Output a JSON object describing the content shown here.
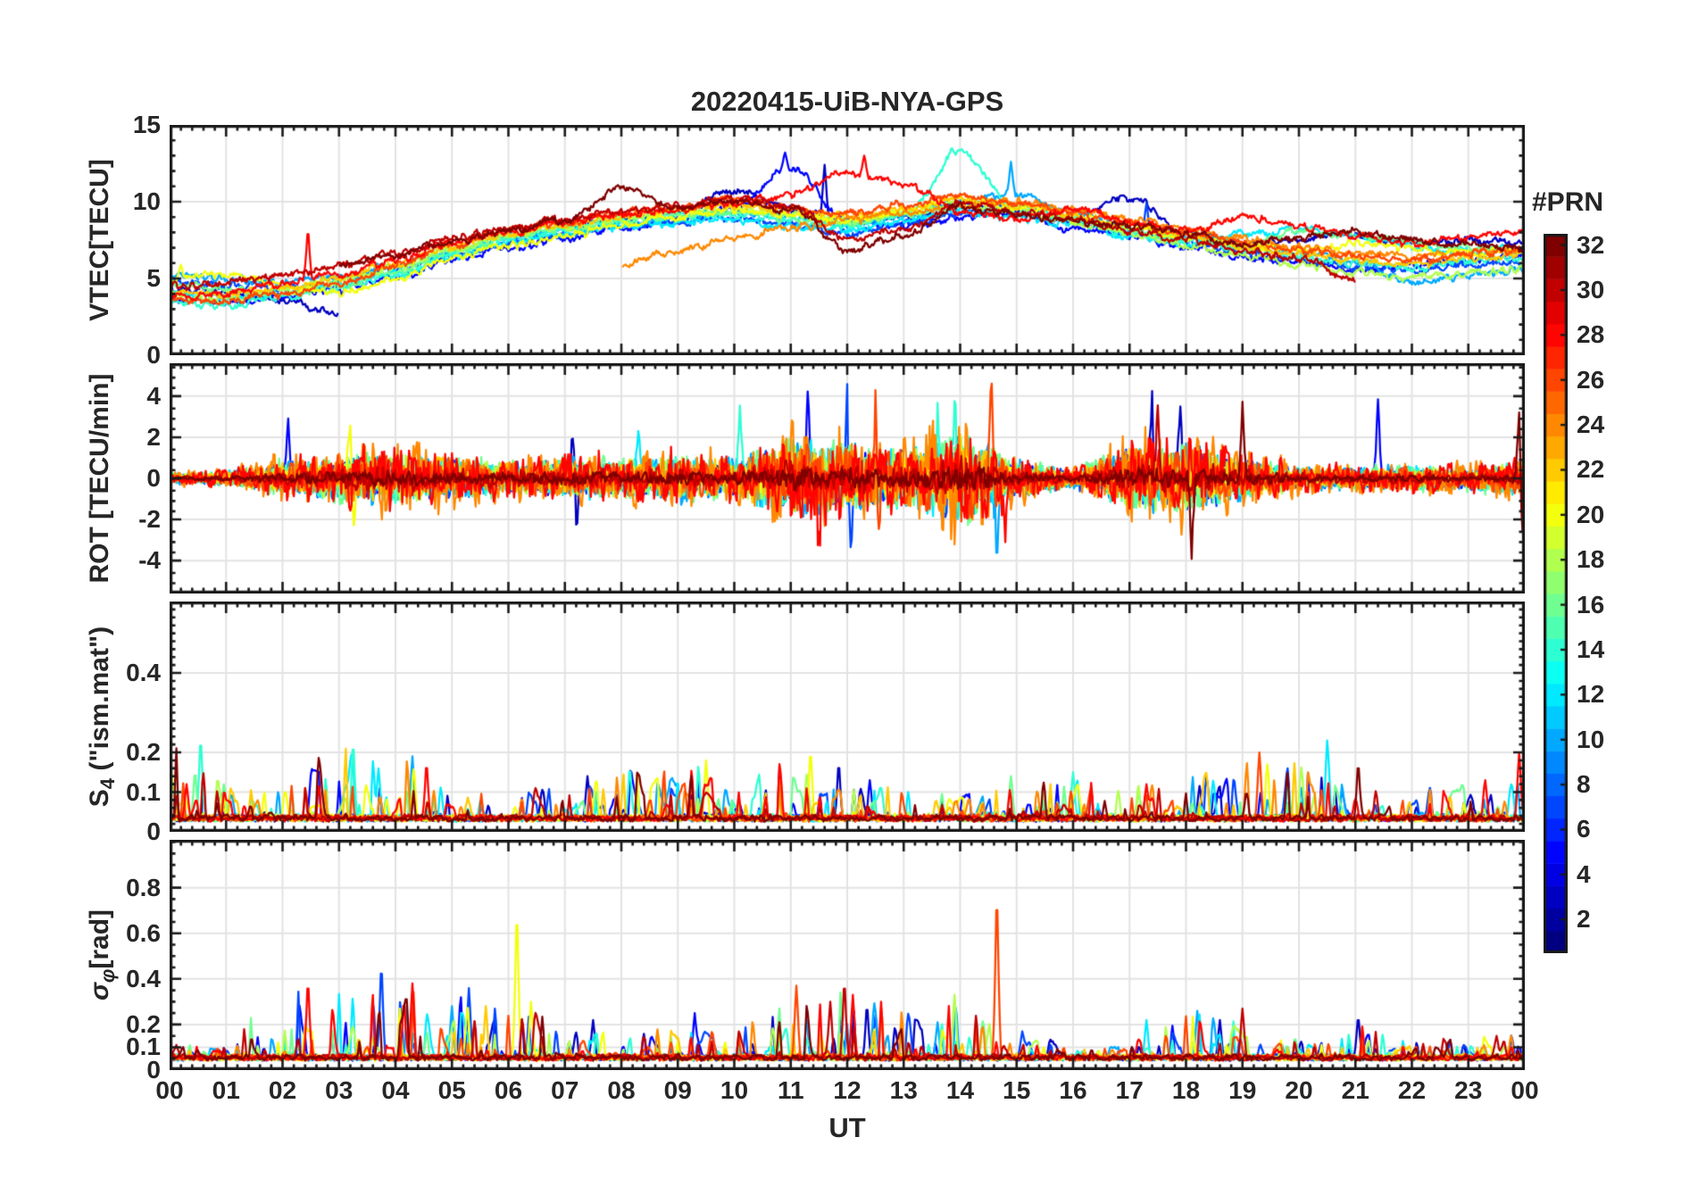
{
  "title": "20220415-UiB-NYA-GPS",
  "colors": {
    "background": "#ffffff",
    "frame": "#1a1a1a",
    "grid": "#e3e3e3",
    "text": "#262626"
  },
  "colorbar": {
    "title": "#PRN",
    "min": 1,
    "max": 32,
    "tick_values": [
      2,
      4,
      6,
      8,
      10,
      12,
      14,
      16,
      18,
      20,
      22,
      24,
      26,
      28,
      30,
      32
    ],
    "colormap": "jet"
  },
  "chart_data": {
    "type": "line",
    "x": {
      "label": "UT",
      "min": 0,
      "max": 24,
      "tick_labels": [
        "00",
        "01",
        "02",
        "03",
        "04",
        "05",
        "06",
        "07",
        "08",
        "09",
        "10",
        "11",
        "12",
        "13",
        "14",
        "15",
        "16",
        "17",
        "18",
        "19",
        "20",
        "21",
        "22",
        "23",
        "00"
      ],
      "minor_step": 0.2,
      "grid": true
    },
    "panels": [
      {
        "id": "vtec",
        "kind": "tec",
        "ylabel": {
          "pre": "VTEC[TECU]",
          "sub": "",
          "post": ""
        },
        "italic": false,
        "ylim": [
          0,
          15
        ],
        "yticks": [
          0,
          5,
          10,
          15
        ],
        "ytick_labels": [
          "0",
          "5",
          "10",
          "15"
        ],
        "minor_step": 1,
        "noise_amp": 0.22,
        "series": [
          {
            "prn": 3,
            "values": [
              4.3,
              4.1,
              3.5,
              2.8,
              null,
              null,
              null,
              8.4,
              8.8,
              9.2,
              10.8,
              9.5,
              8.7,
              9.0,
              9.8,
              9.2,
              8.8,
              10.3,
              8.0,
              7.3,
              7.6,
              7.8,
              7.2,
              7.5,
              7.3
            ]
          },
          {
            "prn": 5,
            "values": [
              3.6,
              3.3,
              3.9,
              4.3,
              5.0,
              6.2,
              7.0,
              7.6,
              8.3,
              8.8,
              9.6,
              12.2,
              8.9,
              8.4,
              9.0,
              9.5,
              8.2,
              7.7,
              7.1,
              6.4,
              6.0,
              5.6,
              5.9,
              6.2,
              6.4
            ]
          },
          {
            "prn": 7,
            "values": [
              4.8,
              4.6,
              4.4,
              4.9,
              5.6,
              6.6,
              7.3,
              7.9,
              8.5,
              8.7,
              9.0,
              8.5,
              8.0,
              8.6,
              9.2,
              9.7,
              8.8,
              8.0,
              7.4,
              6.6,
              6.2,
              5.8,
              5.5,
              5.8,
              6.0
            ]
          },
          {
            "prn": 10,
            "values": [
              5.2,
              5.0,
              4.7,
              5.1,
              5.9,
              6.8,
              7.7,
              8.1,
              8.6,
              8.9,
              9.4,
              9.0,
              8.6,
              9.0,
              9.9,
              10.6,
              9.2,
              8.4,
              7.8,
              7.1,
              6.7,
              6.1,
              4.7,
              5.2,
              5.6
            ]
          },
          {
            "prn": 12,
            "values": [
              4.0,
              3.7,
              4.1,
              4.6,
              5.3,
              6.4,
              7.4,
              8.0,
              8.4,
              8.6,
              8.8,
              8.4,
              8.2,
              8.8,
              9.3,
              9.0,
              8.5,
              7.8,
              7.3,
              7.9,
              8.2,
              7.7,
              7.1,
              6.8,
              7.0
            ]
          },
          {
            "prn": 14,
            "values": [
              3.4,
              3.2,
              3.8,
              4.4,
              5.2,
              6.5,
              7.5,
              8.2,
              8.7,
              9.0,
              9.2,
              8.8,
              8.5,
              9.1,
              13.2,
              9.6,
              8.8,
              8.0,
              7.5,
              6.9,
              6.4,
              6.0,
              5.7,
              6.1,
              6.3
            ]
          },
          {
            "prn": 16,
            "values": [
              4.6,
              4.3,
              4.0,
              4.5,
              5.4,
              6.7,
              7.6,
              8.3,
              8.8,
              9.1,
              9.3,
              8.9,
              8.6,
              9.2,
              9.7,
              9.3,
              8.9,
              8.1,
              7.6,
              7.0,
              8.1,
              7.8,
              7.4,
              7.0,
              6.7
            ]
          },
          {
            "prn": 18,
            "values": [
              3.9,
              3.6,
              4.2,
              4.8,
              5.7,
              6.9,
              7.8,
              8.4,
              8.9,
              9.3,
              9.6,
              9.1,
              8.7,
              9.3,
              9.9,
              9.4,
              8.7,
              7.9,
              7.2,
              6.5,
              5.9,
              5.4,
              5.0,
              5.3,
              5.7
            ]
          },
          {
            "prn": 20,
            "values": [
              4.9,
              5.3,
              4.5,
              4.1,
              5.0,
              6.3,
              7.2,
              7.8,
              8.5,
              9.0,
              9.5,
              9.2,
              8.8,
              9.4,
              10.1,
              9.6,
              9.0,
              8.3,
              7.7,
              7.2,
              6.8,
              7.3,
              7.0,
              6.6,
              6.9
            ]
          },
          {
            "prn": 22,
            "values": [
              4.1,
              3.9,
              4.4,
              5.0,
              6.0,
              7.1,
              7.9,
              8.5,
              9.1,
              9.5,
              9.8,
              9.4,
              9.0,
              9.6,
              10.2,
              9.8,
              9.1,
              8.4,
              7.8,
              7.1,
              6.6,
              6.2,
              5.9,
              6.3,
              6.6
            ]
          },
          {
            "prn": 24,
            "values": [
              null,
              null,
              null,
              null,
              null,
              null,
              null,
              null,
              5.9,
              6.8,
              7.6,
              8.3,
              8.8,
              9.2,
              9.6,
              10.0,
              9.5,
              8.9,
              8.2,
              7.6,
              7.0,
              6.7,
              6.4,
              6.7,
              7.0
            ]
          },
          {
            "prn": 26,
            "values": [
              3.7,
              3.5,
              4.0,
              4.7,
              5.8,
              7.2,
              8.1,
              8.7,
              9.3,
              9.7,
              10.1,
              9.6,
              9.2,
              9.8,
              10.4,
              9.9,
              9.3,
              8.6,
              8.0,
              7.4,
              6.9,
              6.5,
              6.2,
              6.6,
              6.9
            ]
          },
          {
            "prn": 28,
            "values": [
              3.8,
              4.0,
              4.6,
              5.3,
              6.2,
              7.3,
              8.0,
              8.6,
              9.2,
              9.5,
              9.9,
              10.5,
              11.9,
              11.2,
              9.4,
              8.9,
              9.5,
              8.7,
              8.1,
              9.0,
              8.4,
              7.8,
              7.3,
              7.7,
              8.0
            ]
          },
          {
            "prn": 30,
            "values": [
              4.5,
              4.7,
              5.2,
              5.9,
              6.7,
              7.6,
              8.3,
              8.9,
              9.4,
              9.8,
              10.2,
              9.7,
              7.6,
              8.2,
              9.9,
              9.4,
              8.8,
              8.1,
              7.5,
              6.8,
              6.3,
              4.9,
              null,
              null,
              null
            ]
          },
          {
            "prn": 32,
            "values": [
              null,
              null,
              null,
              5.8,
              6.6,
              7.4,
              8.1,
              8.8,
              10.9,
              9.6,
              10.0,
              9.5,
              6.9,
              7.8,
              9.7,
              9.2,
              8.7,
              8.4,
              7.9,
              7.3,
              7.7,
              8.0,
              7.6,
              7.2,
              6.9
            ]
          }
        ],
        "events": [
          [
            10.9,
            5,
            13.2
          ],
          [
            11.6,
            3,
            12.4
          ],
          [
            12.3,
            28,
            13.0
          ],
          [
            13.85,
            14,
            13.5
          ],
          [
            14.9,
            10,
            12.6
          ],
          [
            2.45,
            28,
            8.1
          ],
          [
            0.2,
            20,
            5.9
          ],
          [
            16.9,
            3,
            10.4
          ],
          [
            17.3,
            7,
            9.9
          ]
        ]
      },
      {
        "id": "rot",
        "kind": "rot",
        "ylabel": {
          "pre": "ROT [TECU/min]",
          "sub": "",
          "post": ""
        },
        "italic": false,
        "ylim": [
          -5.6,
          5.6
        ],
        "yticks": [
          -4,
          -2,
          0,
          2,
          4
        ],
        "ytick_labels": [
          "-4",
          "-2",
          "0",
          "2",
          "4"
        ],
        "minor_step": 0.5,
        "prns": [
          3,
          5,
          7,
          10,
          12,
          14,
          16,
          18,
          20,
          22,
          24,
          26,
          28,
          30,
          32
        ],
        "envelope": [
          0.25,
          0.35,
          0.8,
          1.1,
          1.3,
          1.0,
          0.8,
          1.0,
          0.9,
          1.1,
          0.9,
          1.8,
          1.6,
          1.4,
          2.2,
          0.9,
          0.45,
          1.5,
          1.6,
          1.0,
          0.6,
          0.55,
          0.6,
          0.55,
          0.8
        ],
        "events": [
          [
            2.1,
            5,
            2.9
          ],
          [
            3.2,
            20,
            4.1
          ],
          [
            3.25,
            20,
            -4.0
          ],
          [
            7.15,
            3,
            3.4
          ],
          [
            7.2,
            3,
            -3.4
          ],
          [
            8.3,
            12,
            2.3
          ],
          [
            10.1,
            14,
            3.6
          ],
          [
            11.3,
            5,
            4.3
          ],
          [
            11.5,
            28,
            -3.2
          ],
          [
            12.0,
            7,
            4.4
          ],
          [
            12.05,
            7,
            -4.9
          ],
          [
            12.5,
            26,
            4.6
          ],
          [
            12.55,
            26,
            -3.4
          ],
          [
            13.6,
            14,
            3.8
          ],
          [
            13.9,
            14,
            3.4
          ],
          [
            14.55,
            26,
            5.2
          ],
          [
            14.65,
            10,
            -4.9
          ],
          [
            14.8,
            28,
            -3.6
          ],
          [
            17.4,
            3,
            3.9
          ],
          [
            17.5,
            30,
            3.6
          ],
          [
            17.9,
            3,
            4.2
          ],
          [
            18.1,
            32,
            -3.8
          ],
          [
            19.0,
            32,
            3.9
          ],
          [
            21.4,
            5,
            4.2
          ],
          [
            23.9,
            32,
            4.1
          ],
          [
            23.95,
            32,
            -3.9
          ]
        ]
      },
      {
        "id": "s4",
        "kind": "burst",
        "ylabel": {
          "pre": "S",
          "sub": "4",
          "post": " (\"ism.mat\")"
        },
        "italic": false,
        "ylim": [
          0,
          0.58
        ],
        "yticks": [
          0,
          0.1,
          0.2,
          0.4
        ],
        "ytick_labels": [
          "0",
          "0.1",
          "0.2",
          "0.4"
        ],
        "minor_step": 0.02,
        "base": 0.025,
        "prns": [
          3,
          5,
          7,
          10,
          12,
          14,
          16,
          18,
          20,
          22,
          24,
          26,
          28,
          30,
          32
        ],
        "envelope": [
          0.2,
          0.08,
          0.07,
          0.2,
          0.17,
          0.07,
          0.06,
          0.09,
          0.12,
          0.16,
          0.08,
          0.17,
          0.12,
          0.08,
          0.07,
          0.08,
          0.1,
          0.09,
          0.1,
          0.14,
          0.18,
          0.1,
          0.07,
          0.08,
          0.13
        ],
        "events": [
          [
            0.55,
            14,
            0.23
          ],
          [
            0.45,
            16,
            0.15
          ],
          [
            0.3,
            28,
            0.12
          ],
          [
            3.25,
            14,
            0.22
          ],
          [
            3.7,
            12,
            0.16
          ],
          [
            4.3,
            10,
            0.19
          ],
          [
            4.55,
            28,
            0.17
          ],
          [
            7.4,
            3,
            0.14
          ],
          [
            8.15,
            14,
            0.16
          ],
          [
            9.5,
            20,
            0.18
          ],
          [
            11.35,
            20,
            0.2
          ],
          [
            11.85,
            3,
            0.17
          ],
          [
            12.4,
            5,
            0.13
          ],
          [
            14.9,
            16,
            0.14
          ],
          [
            16.0,
            14,
            0.15
          ],
          [
            17.3,
            28,
            0.12
          ],
          [
            19.3,
            26,
            0.2
          ],
          [
            20.5,
            12,
            0.23
          ],
          [
            21.05,
            32,
            0.17
          ],
          [
            23.3,
            28,
            0.13
          ],
          [
            23.9,
            28,
            0.2
          ]
        ]
      },
      {
        "id": "sigma",
        "kind": "burst",
        "ylabel": {
          "pre": "σ",
          "sub": "φ",
          "post": "[rad]"
        },
        "italic": true,
        "ylim": [
          0,
          1.01
        ],
        "yticks": [
          0,
          0.1,
          0.2,
          0.4,
          0.6,
          0.8
        ],
        "ytick_labels": [
          "0",
          "0.1",
          "0.2",
          "0.4",
          "0.6",
          "0.8"
        ],
        "minor_step": 0.05,
        "base": 0.04,
        "prns": [
          3,
          5,
          7,
          10,
          12,
          14,
          16,
          18,
          20,
          22,
          24,
          26,
          28,
          30,
          32
        ],
        "envelope": [
          0.07,
          0.06,
          0.3,
          0.35,
          0.3,
          0.28,
          0.25,
          0.15,
          0.12,
          0.12,
          0.1,
          0.3,
          0.3,
          0.22,
          0.25,
          0.08,
          0.06,
          0.08,
          0.18,
          0.2,
          0.08,
          0.15,
          0.08,
          0.08,
          0.1
        ],
        "events": [
          [
            2.45,
            28,
            0.38
          ],
          [
            3.75,
            7,
            0.45
          ],
          [
            4.15,
            28,
            0.3
          ],
          [
            4.3,
            28,
            0.38
          ],
          [
            5.0,
            10,
            0.28
          ],
          [
            5.3,
            7,
            0.36
          ],
          [
            5.6,
            22,
            0.28
          ],
          [
            6.15,
            20,
            0.68
          ],
          [
            6.4,
            20,
            0.3
          ],
          [
            7.5,
            3,
            0.22
          ],
          [
            9.3,
            5,
            0.25
          ],
          [
            11.1,
            26,
            0.37
          ],
          [
            11.7,
            30,
            0.3
          ],
          [
            11.95,
            30,
            0.38
          ],
          [
            12.1,
            28,
            0.33
          ],
          [
            12.35,
            3,
            0.28
          ],
          [
            12.5,
            7,
            0.24
          ],
          [
            13.6,
            10,
            0.21
          ],
          [
            13.9,
            18,
            0.33
          ],
          [
            14.65,
            26,
            0.75
          ],
          [
            15.1,
            7,
            0.17
          ],
          [
            17.3,
            12,
            0.22
          ],
          [
            18.2,
            10,
            0.26
          ],
          [
            18.6,
            3,
            0.22
          ],
          [
            19.0,
            30,
            0.27
          ],
          [
            21.05,
            3,
            0.23
          ],
          [
            23.5,
            30,
            0.15
          ]
        ]
      }
    ]
  }
}
